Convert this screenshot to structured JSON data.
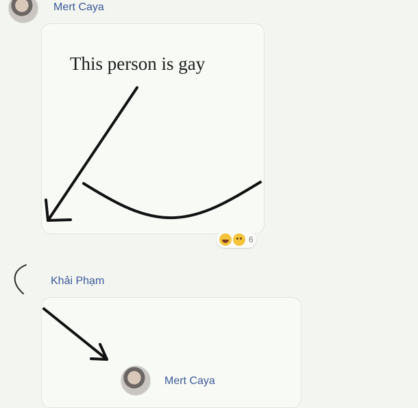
{
  "messages": [
    {
      "sender": "Mert Caya",
      "image_caption": "This person is gay",
      "reactions": {
        "icons": [
          "haha-icon",
          "sad-icon"
        ],
        "count": "6"
      }
    },
    {
      "sender": "Khải Phạm"
    }
  ],
  "quoted_name": "Mert Caya"
}
